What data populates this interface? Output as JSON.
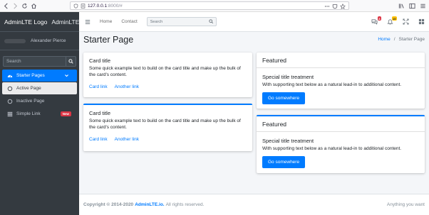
{
  "browser": {
    "url_host": "127.0.0.1",
    "url_rest": ":8000/#"
  },
  "sidebar": {
    "brand_logo": "AdminLTE Logo",
    "brand_text": "AdminLTE 3",
    "user_name": "Alexander Pierce",
    "search_placeholder": "Search",
    "items": [
      {
        "label": "Starter Pages",
        "icon": "dashboard-icon"
      },
      {
        "label": "Active Page",
        "icon": "circle-icon"
      },
      {
        "label": "Inactive Page",
        "icon": "circle-icon"
      },
      {
        "label": "Simple Link",
        "icon": "grid-icon",
        "badge": "New"
      }
    ]
  },
  "topnav": {
    "links": [
      "Home",
      "Contact"
    ],
    "search_placeholder": "Search",
    "messages_count": "3",
    "notifications_count": "15"
  },
  "page": {
    "title": "Starter Page",
    "breadcrumb": [
      "Home",
      "Starter Page"
    ]
  },
  "cards": [
    {
      "title": "Card title",
      "text": "Some quick example text to build on the card title and make up the bulk of the card's content.",
      "link1": "Card link",
      "link2": "Another link"
    },
    {
      "title": "Card title",
      "text": "Some quick example text to build on the card title and make up the bulk of the card's content.",
      "link1": "Card link",
      "link2": "Another link"
    }
  ],
  "featured": [
    {
      "header": "Featured",
      "title": "Special title treatment",
      "text": "With supporting text below as a natural lead-in to additional content.",
      "button": "Go somewhere"
    },
    {
      "header": "Featured",
      "title": "Special title treatment",
      "text": "With supporting text below as a natural lead-in to additional content.",
      "button": "Go somewhere"
    }
  ],
  "footer": {
    "copyright": "Copyright © 2014-2020",
    "link": "AdminLTE.io.",
    "rights": "All rights reserved.",
    "right_text": "Anything you want"
  },
  "colors": {
    "primary": "#007bff",
    "sidebar_bg": "#343a40",
    "danger": "#dc3545",
    "warning": "#ffc107",
    "content_bg": "#f4f6f9"
  }
}
